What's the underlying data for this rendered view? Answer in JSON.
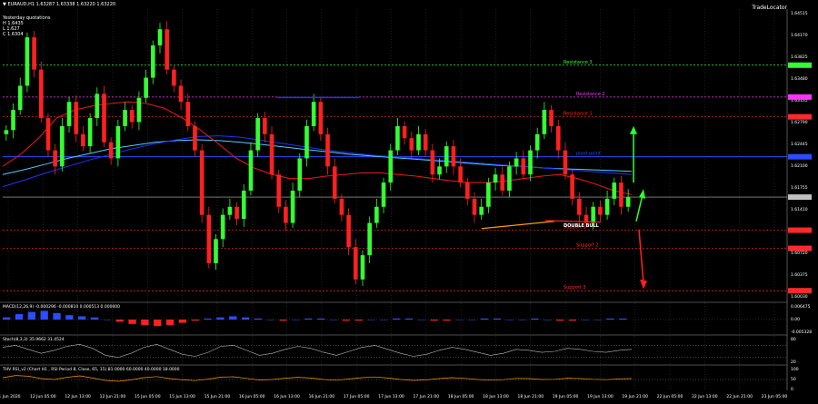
{
  "window": {
    "symbol_title": "EURAUD,H1  1.63287 1.63338 1.63220 1.63220",
    "menu_glyph": "▼"
  },
  "info_panel": {
    "title": "Yesterday quotations",
    "high": "H 1.6435",
    "low": "L 1.627",
    "close": "C 1.6304"
  },
  "brand_label": "TradeLocator",
  "price_axis": {
    "ticks": [
      "1.64515",
      "1.64170",
      "1.63825",
      "1.63480",
      "1.63135",
      "1.62790",
      "1.62445",
      "1.62100",
      "1.61755",
      "1.61410",
      "1.61065",
      "1.60720",
      "1.60375",
      "1.60030"
    ],
    "tag_labels": [
      "1.65900",
      "1.64855",
      "1.64460",
      "1.64215",
      "1.63720",
      "1.63220",
      "1.62810",
      "1.62585",
      "1.62060"
    ]
  },
  "chart_data": {
    "type": "candlestick",
    "symbol": "EURAUD",
    "timeframe": "H1",
    "levels": [
      {
        "name": "Resistance 3",
        "price": 1.64855,
        "color": "#33ff33"
      },
      {
        "name": "Resistance 2",
        "price": 1.6446,
        "color": "#ff33ff"
      },
      {
        "name": "Resistance 1",
        "price": 1.64215,
        "color": "#ff2a2a"
      },
      {
        "name": "pivot point",
        "price": 1.6372,
        "color": "#2a4dff"
      },
      {
        "name": "Support 1",
        "price": 1.6281,
        "color": "#ff2a2a"
      },
      {
        "name": "Support 2",
        "price": 1.62585,
        "color": "#ff2a2a"
      },
      {
        "name": "Support 3",
        "price": 1.6206,
        "color": "#ff2a2a"
      }
    ],
    "current_price": 1.6322,
    "annotation": "DOUBLE BULL",
    "x_labels": [
      "11 Jun 2020",
      "12 Jun 05:00",
      "12 Jun 13:00",
      "12 Jun 21:00",
      "15 Jun 05:00",
      "15 Jun 13:00",
      "15 Jun 21:00",
      "16 Jun 05:00",
      "16 Jun 13:00",
      "16 Jun 21:00",
      "17 Jun 05:00",
      "17 Jun 13:00",
      "17 Jun 21:00",
      "18 Jun 05:00",
      "18 Jun 13:00",
      "18 Jun 21:00",
      "19 Jun 05:00",
      "19 Jun 13:00",
      "19 Jun 21:00",
      "22 Jun 05:00",
      "22 Jun 13:00",
      "22 Jun 21:00",
      "23 Jun 05:00"
    ],
    "closes": [
      1.6405,
      1.643,
      1.646,
      1.652,
      1.648,
      1.642,
      1.638,
      1.636,
      1.641,
      1.644,
      1.64,
      1.6385,
      1.642,
      1.645,
      1.639,
      1.637,
      1.641,
      1.643,
      1.6415,
      1.6445,
      1.647,
      1.651,
      1.653,
      1.648,
      1.646,
      1.644,
      1.641,
      1.638,
      1.63,
      1.624,
      1.627,
      1.63,
      1.631,
      1.6295,
      1.633,
      1.638,
      1.642,
      1.64,
      1.635,
      1.631,
      1.629,
      1.633,
      1.637,
      1.641,
      1.644,
      1.64,
      1.636,
      1.632,
      1.63,
      1.626,
      1.622,
      1.625,
      1.629,
      1.631,
      1.634,
      1.638,
      1.641,
      1.6395,
      1.638,
      1.64,
      1.638,
      1.635,
      1.636,
      1.6385,
      1.636,
      1.634,
      1.632,
      1.63,
      1.631,
      1.634,
      1.635,
      1.633,
      1.636,
      1.637,
      1.635,
      1.638,
      1.64,
      1.643,
      1.641,
      1.638,
      1.635,
      1.632,
      1.63,
      1.629,
      1.631,
      1.63,
      1.632,
      1.634,
      1.631,
      1.6322
    ],
    "ma_red": [
      1.636,
      1.6375,
      1.6395,
      1.642,
      1.643,
      1.6435,
      1.6438,
      1.644,
      1.6438,
      1.6432,
      1.642,
      1.6405,
      1.6388,
      1.637,
      1.6358,
      1.635,
      1.6345,
      1.6345,
      1.6348,
      1.635,
      1.6352,
      1.6352,
      1.635,
      1.6348,
      1.6345,
      1.6342,
      1.634,
      1.634,
      1.6342,
      1.6345,
      1.6348,
      1.635,
      1.6345,
      1.6338,
      1.633,
      1.6325
    ],
    "ma_blue": [
      1.6335,
      1.6343,
      1.6352,
      1.636,
      1.6368,
      1.6375,
      1.6382,
      1.6388,
      1.6393,
      1.6397,
      1.6398,
      1.6396,
      1.6392,
      1.6388,
      1.6384,
      1.638,
      1.6377,
      1.6374,
      1.6372,
      1.637,
      1.6368,
      1.6366,
      1.6364,
      1.6362,
      1.636,
      1.6358,
      1.6356,
      1.6354,
      1.6352,
      1.635
    ],
    "ma_cyan": [
      1.635,
      1.6356,
      1.6363,
      1.637,
      1.6376,
      1.6382,
      1.6386,
      1.639,
      1.6392,
      1.6393,
      1.6392,
      1.639,
      1.6387,
      1.6384,
      1.6381,
      1.6378,
      1.6375,
      1.6373,
      1.6371,
      1.6369,
      1.6367,
      1.6365,
      1.6363,
      1.6361,
      1.636,
      1.6358,
      1.6357,
      1.6356,
      1.6355,
      1.6354
    ],
    "macd_hist": [
      0.0002,
      0.0005,
      0.0007,
      0.0008,
      0.0006,
      0.0004,
      0.0003,
      0.0002,
      0.0,
      -0.0002,
      -0.0004,
      -0.0005,
      -0.0006,
      -0.0005,
      -0.0003,
      -0.0001,
      0.0001,
      0.0002,
      0.0003,
      0.0002,
      0.0001,
      0.0,
      -0.0001,
      0.0,
      0.0001,
      0.0001,
      0.0,
      -0.0001,
      -0.0001,
      0.0,
      0.0,
      0.0001,
      0.0001,
      0.0,
      -0.0001,
      -0.0001,
      0.0,
      0.0,
      0.0001,
      0.0001,
      0.0,
      0.0,
      0.0001,
      0.0,
      -0.0001,
      -0.0001,
      0.0,
      0.0,
      0.0001,
      0.0001
    ],
    "stoch_main": [
      70,
      80,
      60,
      40,
      55,
      75,
      85,
      65,
      30,
      20,
      40,
      70,
      85,
      60,
      35,
      25,
      45,
      75,
      80,
      55,
      30,
      40,
      60,
      75,
      65,
      45,
      30,
      50,
      70,
      80,
      60,
      40,
      25,
      35,
      55,
      70,
      60,
      45,
      30,
      40,
      60,
      55,
      45,
      50,
      65,
      60,
      50,
      45,
      55,
      60
    ],
    "rsi": [
      60,
      72,
      68,
      55,
      50,
      62,
      70,
      58,
      45,
      40,
      48,
      60,
      66,
      55,
      48,
      44,
      52,
      63,
      65,
      56,
      47,
      50,
      57,
      62,
      58,
      50,
      46,
      53,
      60,
      64,
      58,
      50,
      45,
      48,
      55,
      60,
      56,
      50,
      46,
      49,
      56,
      55,
      50,
      51,
      57,
      55,
      51,
      49,
      53,
      55
    ]
  },
  "indicators": {
    "macd_label": "MACD(12,26,9) -0.000296 -0.000810 0.000513 0.000000",
    "macd_ticks": [
      "0.006475",
      "0.00",
      "-0.005328"
    ],
    "stoch_label": "Stoch(8,3,3) 35.9662 31.4524",
    "stoch_ticks": [
      "80",
      "20"
    ],
    "rsi_label": "THV RSI_v2 (Chart H1 , RSI Period 8, Close, 65, 15)  81.0000 60.0000 40.0000 18.0000",
    "rsi_ticks": [
      "100",
      "50",
      "0"
    ]
  },
  "colors": {
    "bull": "#33ff33",
    "bear": "#ff2020",
    "ma_red": "#e01818",
    "ma_blue": "#2233ff",
    "ma_cyan": "#55ccff",
    "grid": "#3a3a3a",
    "current_price_tag": "#c0c0c0"
  }
}
